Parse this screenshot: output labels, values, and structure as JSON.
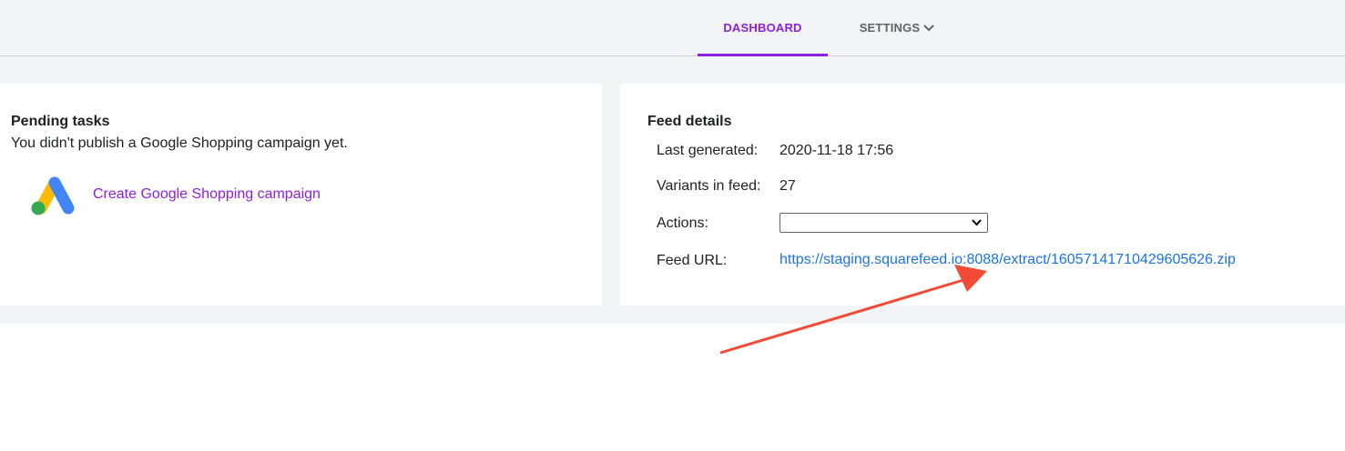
{
  "nav": {
    "tabs": [
      {
        "label": "DASHBOARD",
        "active": true
      },
      {
        "label": "SETTINGS",
        "active": false,
        "icon": "chevron-down-icon"
      }
    ]
  },
  "pending": {
    "title": "Pending tasks",
    "message": "You didn't publish a Google Shopping campaign yet.",
    "logo_icon": "google-ads-logo",
    "link_label": "Create Google Shopping campaign"
  },
  "feed": {
    "title": "Feed details",
    "last_generated_label": "Last generated:",
    "last_generated_value": "2020-11-18 17:56",
    "variants_label": "Variants in feed:",
    "variants_value": "27",
    "actions_label": "Actions:",
    "actions_selected": "",
    "url_label": "Feed URL:",
    "url_value": "https://staging.squarefeed.io:8088/extract/16057141710429605626.zip"
  },
  "annotation": {
    "arrow_icon": "red-annotation-arrow",
    "color": "#f24a35"
  },
  "colors": {
    "accent": "#8e1ee0",
    "link": "#1a73e8",
    "background": "#f3f4f6"
  }
}
